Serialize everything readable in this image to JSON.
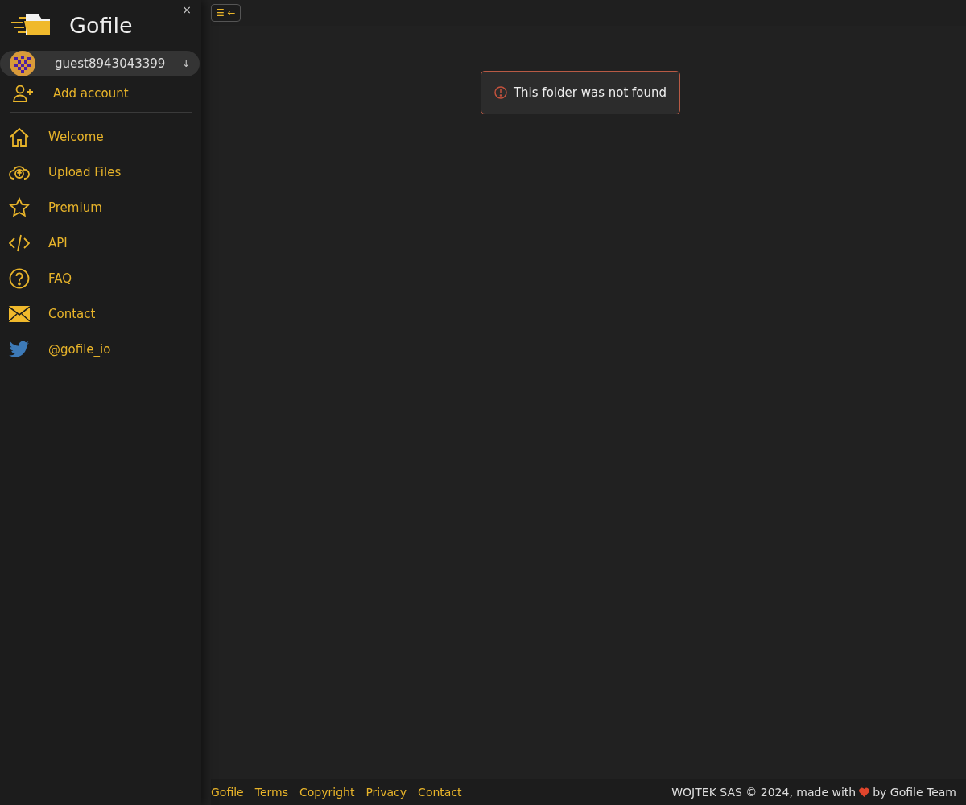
{
  "sidebar": {
    "brand": "Gofile",
    "close": "×",
    "account": {
      "name": "guest8943043399",
      "toggle": "↓"
    },
    "add_account": "Add account",
    "items": [
      {
        "kind": "home",
        "label": "Welcome"
      },
      {
        "kind": "upload",
        "label": "Upload Files"
      },
      {
        "kind": "star",
        "label": "Premium"
      },
      {
        "kind": "code",
        "label": "API"
      },
      {
        "kind": "help",
        "label": "FAQ"
      },
      {
        "kind": "mail",
        "label": "Contact"
      },
      {
        "kind": "bird",
        "label": "@gofile_io"
      }
    ]
  },
  "toolbar": {
    "menu_toggle": "☰ ←"
  },
  "alert": {
    "message": "This folder was not found"
  },
  "footer": {
    "links": [
      "Gofile",
      "Terms",
      "Copyright",
      "Privacy",
      "Contact"
    ],
    "credit_before": "WOJTEK SAS © 2024, made with",
    "credit_after": "by Gofile Team"
  }
}
